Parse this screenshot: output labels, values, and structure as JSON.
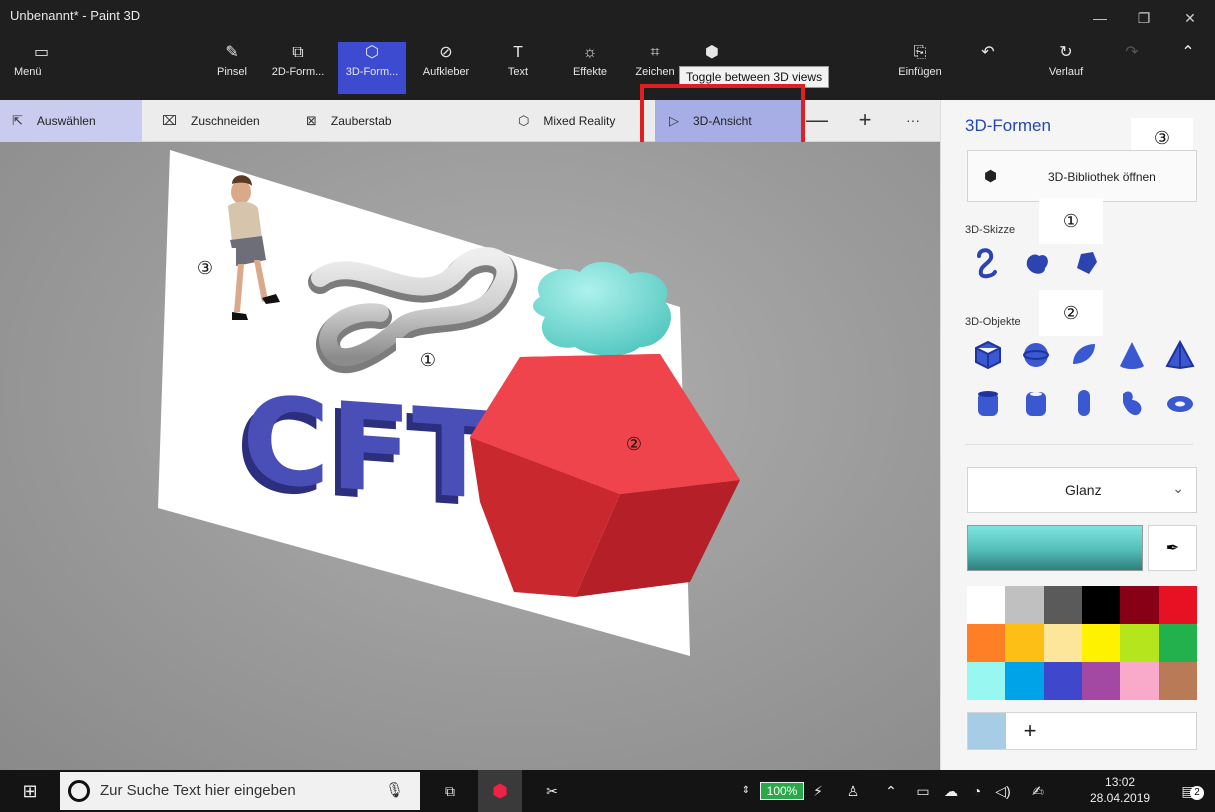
{
  "window": {
    "title": "Unbenannt* - Paint 3D",
    "minimize_icon": "—",
    "restore_icon": "❐",
    "close_icon": "✕"
  },
  "ribbon": {
    "menu": "Menü",
    "tools": [
      {
        "label": "Pinsel",
        "icon": "brush-icon"
      },
      {
        "label": "2D-Form...",
        "icon": "2d-shapes-icon"
      },
      {
        "label": "3D-Form...",
        "icon": "3d-shapes-icon"
      },
      {
        "label": "Aufkleber",
        "icon": "sticker-icon"
      },
      {
        "label": "Text",
        "icon": "text-icon"
      },
      {
        "label": "Effekte",
        "icon": "effects-icon"
      },
      {
        "label": "Zeichen",
        "icon": "canvas-icon"
      }
    ],
    "paste": "Einfügen",
    "history": "Verlauf",
    "tooltip": "Toggle between 3D views"
  },
  "toolbar": {
    "select": "Auswählen",
    "crop": "Zuschneiden",
    "magic_select": "Zauberstab",
    "mixed_reality": "Mixed Reality",
    "view_3d": "3D-Ansicht",
    "zoom_out": "—",
    "zoom_in": "+",
    "more": "···"
  },
  "canvas": {
    "labels": {
      "person": "③",
      "tube": "①",
      "cube": "②"
    }
  },
  "panel": {
    "title": "3D-Formen",
    "badge_top": "③",
    "library_button": "3D-Bibliothek öffnen",
    "sketch_label": "3D-Skizze",
    "sketch_badge": "①",
    "objects_label": "3D-Objekte",
    "objects_badge": "②",
    "material": "Glanz",
    "accent_color": "#2446b5",
    "current_color": "#5ccac4",
    "palette": [
      "#ffffff",
      "#c0c0c0",
      "#5a5a5a",
      "#000000",
      "#880015",
      "#e81123",
      "#ff7f27",
      "#fdbf15",
      "#fde59a",
      "#fff200",
      "#b5e61d",
      "#22b14c",
      "#99f7f2",
      "#00a2e8",
      "#3f48cc",
      "#a349a4",
      "#f9a9c9",
      "#b97a57"
    ],
    "custom_color": "#a6cce6",
    "add_color": "+"
  },
  "taskbar": {
    "search_placeholder": "Zur Suche Text hier eingeben",
    "battery": "100%",
    "time": "13:02",
    "date": "28.04.2019",
    "notifications": "2"
  }
}
